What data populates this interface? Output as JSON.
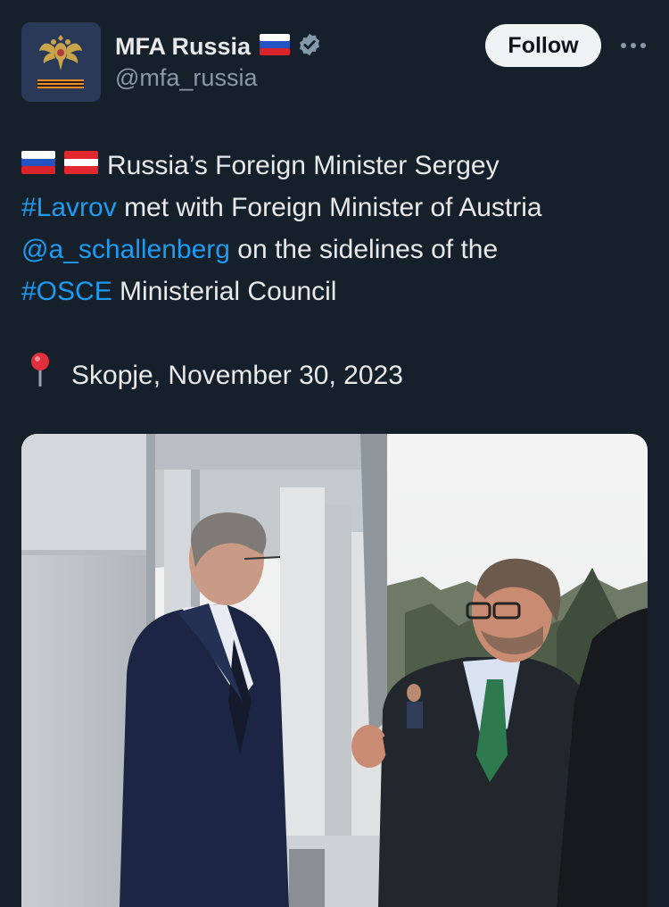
{
  "account": {
    "display_name": "MFA Russia",
    "handle": "@mfa_russia",
    "verified": true,
    "avatar_icon": "russian-coat-of-arms-icon",
    "name_flag_icon": "russia-flag-icon"
  },
  "actions": {
    "follow_label": "Follow",
    "more_icon": "more-options-icon"
  },
  "tweet": {
    "lines": [
      {
        "flags": [
          "russia-flag-icon",
          "austria-flag-icon"
        ],
        "text": "Russia’s Foreign Minister Sergey"
      },
      {
        "hashtag": "#Lavrov",
        "text": " met with Foreign Minister of Austria"
      },
      {
        "mention": "@a_schallenberg",
        "text": " on the sidelines of the"
      },
      {
        "hashtag": "#OSCE",
        "text": " Ministerial Council"
      }
    ],
    "location_icon": "location-pin-icon",
    "location": "Skopje, November 30, 2023"
  },
  "media": {
    "type": "photo",
    "subject": "two-men-meeting-photo"
  },
  "colors": {
    "background": "#15202b",
    "text": "#e7e9ea",
    "secondary_text": "#8b98a5",
    "link": "#1d9bf0",
    "follow_button_bg": "#eff3f4",
    "verified_badge": "#829aab"
  }
}
